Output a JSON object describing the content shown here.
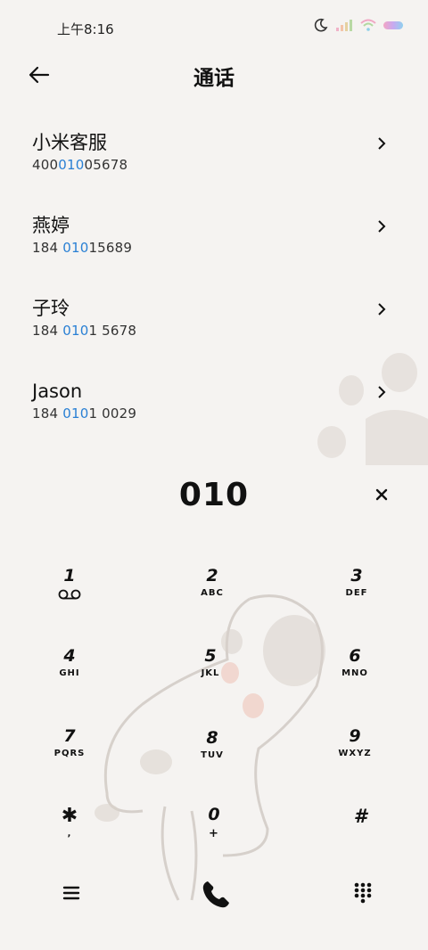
{
  "status_bar": {
    "time": "上午8:16",
    "icons": [
      "moon-icon",
      "signal-icon",
      "wifi-icon",
      "battery-icon"
    ]
  },
  "header": {
    "title": "通话",
    "back_icon": "arrow-left-icon"
  },
  "contacts": [
    {
      "name": "小米客服",
      "number_parts": [
        "400",
        "010",
        "05678"
      ]
    },
    {
      "name": "燕婷",
      "number_parts": [
        "184 ",
        "010",
        "15689"
      ]
    },
    {
      "name": "子玲",
      "number_parts": [
        "184 ",
        "010",
        "1 5678"
      ]
    },
    {
      "name": "Jason",
      "number_parts": [
        "184 ",
        "010",
        "1 0029"
      ]
    }
  ],
  "dial": {
    "number": "010",
    "clear_icon": "close-icon"
  },
  "keypad": [
    {
      "digit": "1",
      "letters": ""
    },
    {
      "digit": "2",
      "letters": "ABC"
    },
    {
      "digit": "3",
      "letters": "DEF"
    },
    {
      "digit": "4",
      "letters": "GHI"
    },
    {
      "digit": "5",
      "letters": "JKL"
    },
    {
      "digit": "6",
      "letters": "MNO"
    },
    {
      "digit": "7",
      "letters": "PQRS"
    },
    {
      "digit": "8",
      "letters": "TUV"
    },
    {
      "digit": "9",
      "letters": "WXYZ"
    },
    {
      "digit": "✱",
      "letters": ","
    },
    {
      "digit": "0",
      "letters": "+"
    },
    {
      "digit": "#",
      "letters": ""
    }
  ],
  "bottom_bar": {
    "menu_icon": "menu-icon",
    "call_icon": "phone-icon",
    "dialpad_icon": "dialpad-icon"
  },
  "colors": {
    "background": "#f5f3f1",
    "highlight": "#2a80d4",
    "text": "#111111"
  }
}
